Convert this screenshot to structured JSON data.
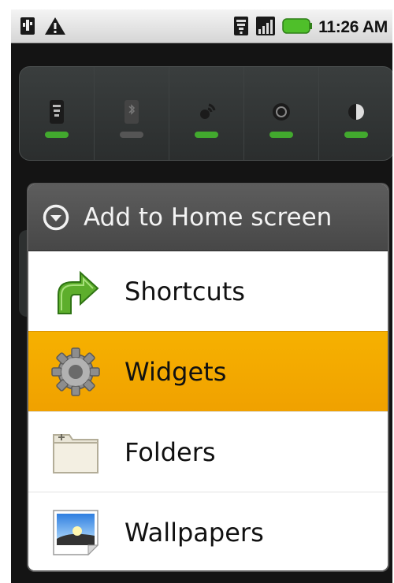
{
  "status_bar": {
    "time": "11:26 AM",
    "left_icons": [
      "usb-icon",
      "warning-icon"
    ],
    "right_icons": [
      "wifi-icon",
      "signal-icon",
      "battery-icon"
    ]
  },
  "power_widget": {
    "toggles": [
      {
        "icon": "wifi-toggle-icon",
        "on": true
      },
      {
        "icon": "bluetooth-toggle-icon",
        "on": false
      },
      {
        "icon": "gps-toggle-icon",
        "on": true
      },
      {
        "icon": "sync-toggle-icon",
        "on": true
      },
      {
        "icon": "brightness-toggle-icon",
        "on": true
      }
    ]
  },
  "dialog": {
    "title": "Add to Home screen",
    "header_icon": "chevron-down-circle-icon",
    "items": [
      {
        "label": "Shortcuts",
        "icon": "shortcut-arrow-icon",
        "selected": false
      },
      {
        "label": "Widgets",
        "icon": "gear-icon",
        "selected": true
      },
      {
        "label": "Folders",
        "icon": "folder-icon",
        "selected": false
      },
      {
        "label": "Wallpapers",
        "icon": "wallpaper-icon",
        "selected": false
      }
    ]
  },
  "colors": {
    "selection": "#f2a600",
    "toggle_on": "#42a92e",
    "header": "#525252"
  }
}
